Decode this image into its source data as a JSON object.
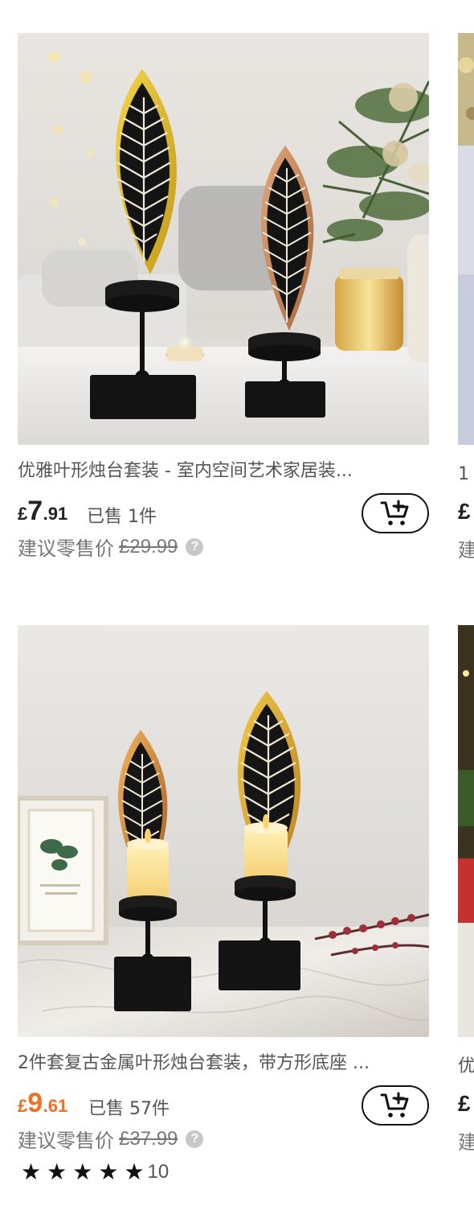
{
  "products": [
    {
      "title": "优雅叶形烛台套装 - 室内空间艺术家居装...",
      "price_currency": "£",
      "price_int": "7",
      "price_dec": ".91",
      "sold": "已售 1件",
      "msrp_label": "建议零售价",
      "msrp_value": "£29.99",
      "price_color": "#222222"
    },
    {
      "title": "2件套复古金属叶形烛台套装，带方形底座 ...",
      "price_currency": "£",
      "price_int": "9",
      "price_dec": ".61",
      "sold": "已售 57件",
      "msrp_label": "建议零售价",
      "msrp_value": "£37.99",
      "price_color": "#f36f23",
      "rating_stars": 5,
      "rating_count": "10"
    }
  ],
  "peek_products": [
    {
      "title_fragment": "1",
      "price_fragment": "£",
      "msrp_fragment": "建"
    },
    {
      "title_fragment": "优",
      "price_fragment": "£",
      "msrp_fragment": "建"
    }
  ],
  "icons": {
    "cart": "add-to-cart-icon",
    "help": "help-icon",
    "star": "star-icon"
  },
  "help_glyph": "?",
  "star_glyph": "★"
}
